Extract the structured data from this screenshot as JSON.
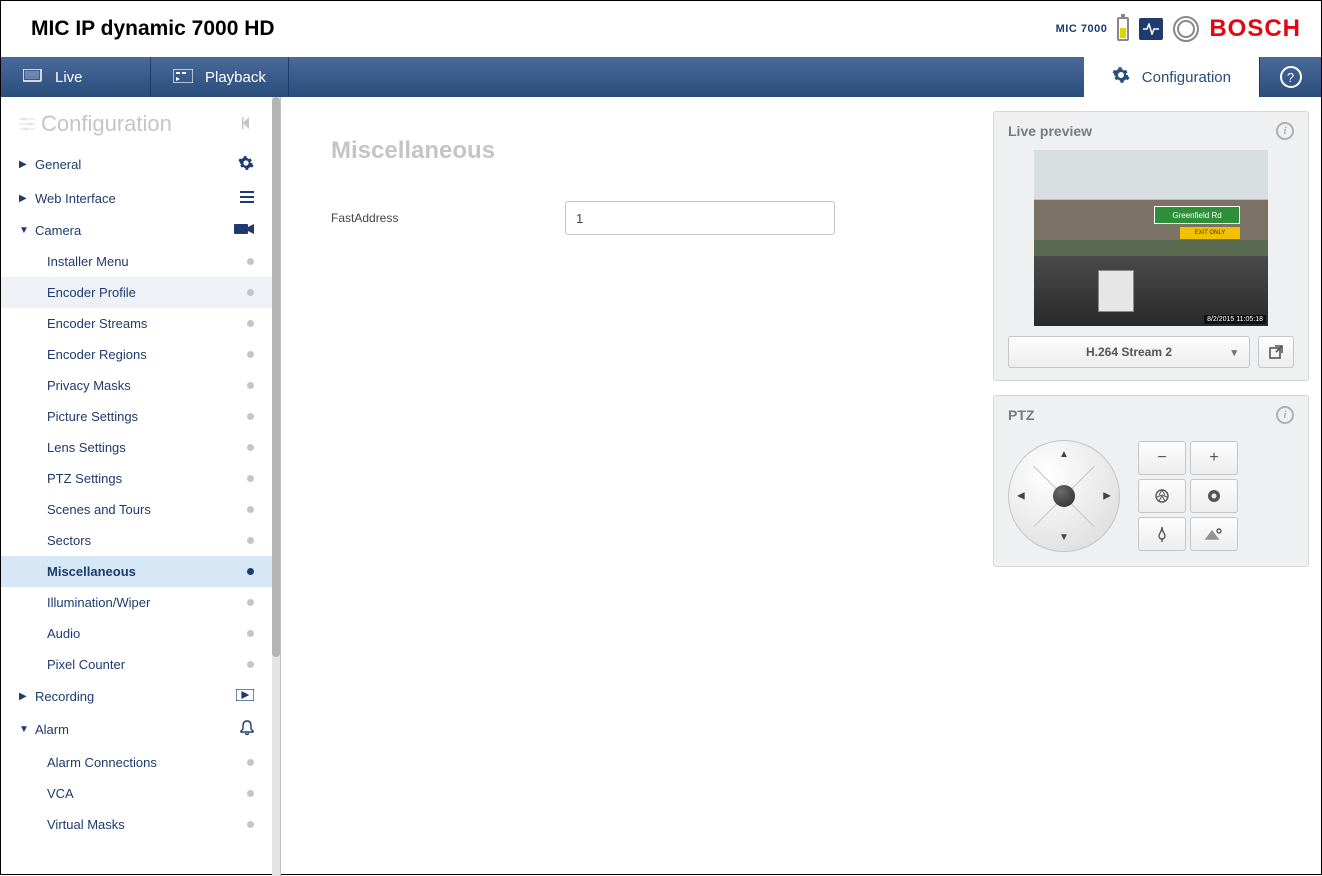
{
  "header": {
    "device_title": "MIC IP dynamic 7000 HD",
    "mic_label": "MIC 7000",
    "brand": "BOSCH"
  },
  "tabs": {
    "live": "Live",
    "playback": "Playback",
    "configuration": "Configuration"
  },
  "sidebar": {
    "title": "Configuration",
    "sections": {
      "general": "General",
      "web_interface": "Web Interface",
      "camera": "Camera",
      "recording": "Recording",
      "alarm": "Alarm"
    },
    "camera_items": [
      "Installer Menu",
      "Encoder Profile",
      "Encoder Streams",
      "Encoder Regions",
      "Privacy Masks",
      "Picture Settings",
      "Lens Settings",
      "PTZ Settings",
      "Scenes and Tours",
      "Sectors",
      "Miscellaneous",
      "Illumination/Wiper",
      "Audio",
      "Pixel Counter"
    ],
    "alarm_items": [
      "Alarm Connections",
      "VCA",
      "Virtual Masks"
    ]
  },
  "content": {
    "title": "Miscellaneous",
    "fastaddress_label": "FastAddress",
    "fastaddress_value": "1"
  },
  "right": {
    "live_preview_title": "Live preview",
    "sign_text": "Greenfield Rd",
    "sign2_text": "EXIT ONLY",
    "timestamp": "8/2/2015  11:05:18",
    "stream_label": "H.264 Stream 2",
    "ptz_title": "PTZ"
  }
}
